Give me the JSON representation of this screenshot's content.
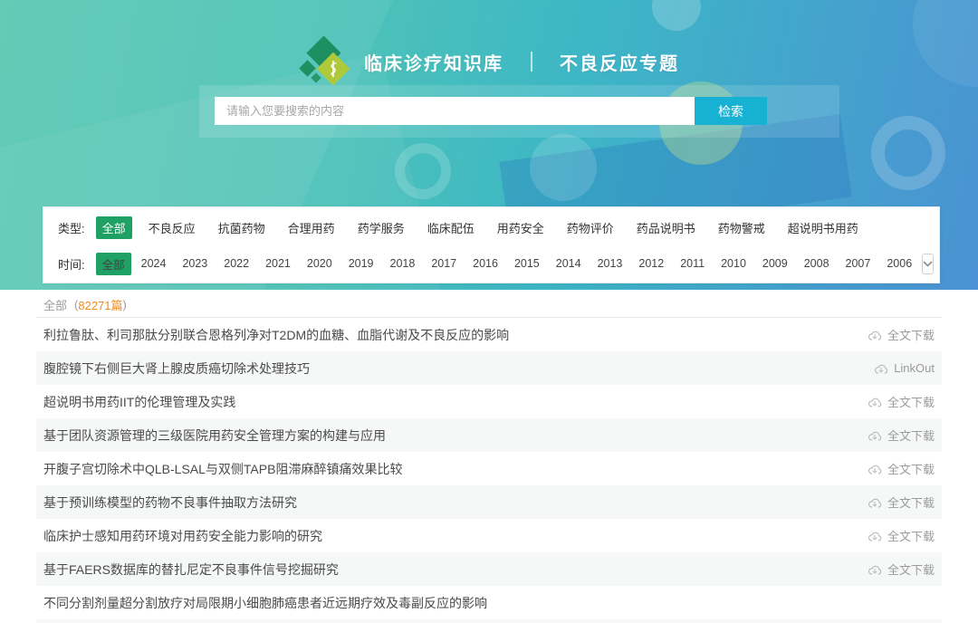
{
  "brand": {
    "title": "临床诊疗知识库",
    "subtitle": "不良反应专题"
  },
  "search": {
    "placeholder": "请输入您要搜索的内容",
    "button_label": "检索",
    "button_color": "#17b1d4"
  },
  "filters": {
    "selected_color": "#1fa065",
    "type": {
      "label": "类型:",
      "selected": "全部",
      "options": [
        "全部",
        "不良反应",
        "抗菌药物",
        "合理用药",
        "药学服务",
        "临床配伍",
        "用药安全",
        "药物评价",
        "药品说明书",
        "药物警戒",
        "超说明书用药"
      ]
    },
    "time": {
      "label": "时间:",
      "selected": "全部",
      "options": [
        "全部",
        "2024",
        "2023",
        "2022",
        "2021",
        "2020",
        "2019",
        "2018",
        "2017",
        "2016",
        "2015",
        "2014",
        "2013",
        "2012",
        "2011",
        "2010",
        "2009",
        "2008",
        "2007",
        "2006"
      ]
    }
  },
  "list_header": {
    "label": "全部",
    "paren_open": "(",
    "count": "82271篇",
    "paren_close": ")",
    "count_color": "#f08c1e"
  },
  "articles": [
    {
      "title": "利拉鲁肽、利司那肽分别联合恩格列净对T2DM的血糖、血脂代谢及不良反应的影响",
      "action": "全文下载",
      "icon": "cloud-download-icon"
    },
    {
      "title": "腹腔镜下右侧巨大肾上腺皮质癌切除术处理技巧",
      "action": "LinkOut",
      "icon": "cloud-download-icon"
    },
    {
      "title": "超说明书用药IIT的伦理管理及实践",
      "action": "全文下载",
      "icon": "cloud-download-icon"
    },
    {
      "title": "基于团队资源管理的三级医院用药安全管理方案的构建与应用",
      "action": "全文下载",
      "icon": "cloud-download-icon"
    },
    {
      "title": "开腹子宫切除术中QLB-LSAL与双侧TAPB阻滞麻醉镇痛效果比较",
      "action": "全文下载",
      "icon": "cloud-download-icon"
    },
    {
      "title": "基于预训练模型的药物不良事件抽取方法研究",
      "action": "全文下载",
      "icon": "cloud-download-icon"
    },
    {
      "title": "临床护士感知用药环境对用药安全能力影响的研究",
      "action": "全文下载",
      "icon": "cloud-download-icon"
    },
    {
      "title": "基于FAERS数据库的替扎尼定不良事件信号挖掘研究",
      "action": "全文下载",
      "icon": "cloud-download-icon"
    },
    {
      "title": "不同分割剂量超分割放疗对局限期小细胞肺癌患者近远期疗效及毒副反应的影响",
      "action": "",
      "icon": ""
    }
  ]
}
